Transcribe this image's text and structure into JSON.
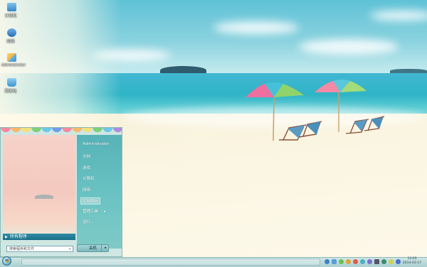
{
  "desktop_icons": [
    {
      "label": "计算机",
      "color": "#5aa7dd"
    },
    {
      "label": "网络",
      "color": "#3c88c9"
    },
    {
      "label": "Administrator",
      "color": "#e9c25a"
    },
    {
      "label": "回收站",
      "color": "#4ca3d8"
    }
  ],
  "start_menu": {
    "username": "Administrator",
    "items": [
      "文档",
      "游戏",
      "计算机",
      "网络",
      "控制面板",
      "管理工具",
      "运行..."
    ],
    "all_programs_label": "所有程序",
    "search_placeholder": "搜索程序和文件",
    "shutdown_label": "关机"
  },
  "taskbar": {
    "clock_time": "13:03",
    "clock_date": "2014-03-17"
  },
  "colors": {
    "accent": "#2e8da6",
    "scallops": [
      "#f58aa0",
      "#f7b96b",
      "#f4e07a",
      "#7fd07c",
      "#6ec8e6",
      "#6f9fe8",
      "#f58aa0",
      "#f7b96b",
      "#f4e07a",
      "#7fd07c",
      "#6ec8e6",
      "#b08be0"
    ]
  }
}
